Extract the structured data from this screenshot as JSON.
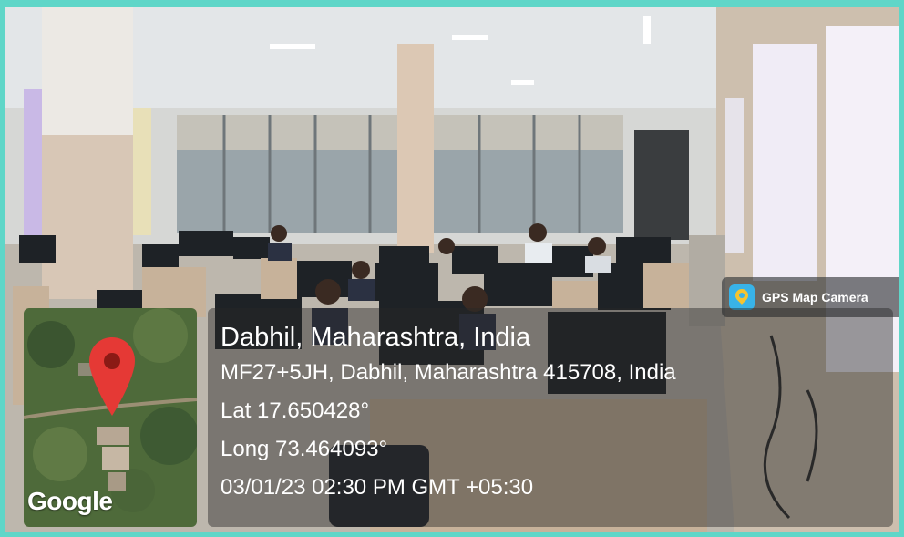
{
  "badge": {
    "label": "GPS Map Camera",
    "icon": "gps-map-camera-logo-icon"
  },
  "map": {
    "brand": "Google",
    "pin_color": "#e53935"
  },
  "location": {
    "place": "Dabhil, Maharashtra, India",
    "address": "MF27+5JH, Dabhil, Maharashtra 415708, India",
    "lat": "Lat 17.650428°",
    "long": "Long 73.464093°",
    "datetime": "03/01/23 02:30 PM GMT +05:30"
  }
}
